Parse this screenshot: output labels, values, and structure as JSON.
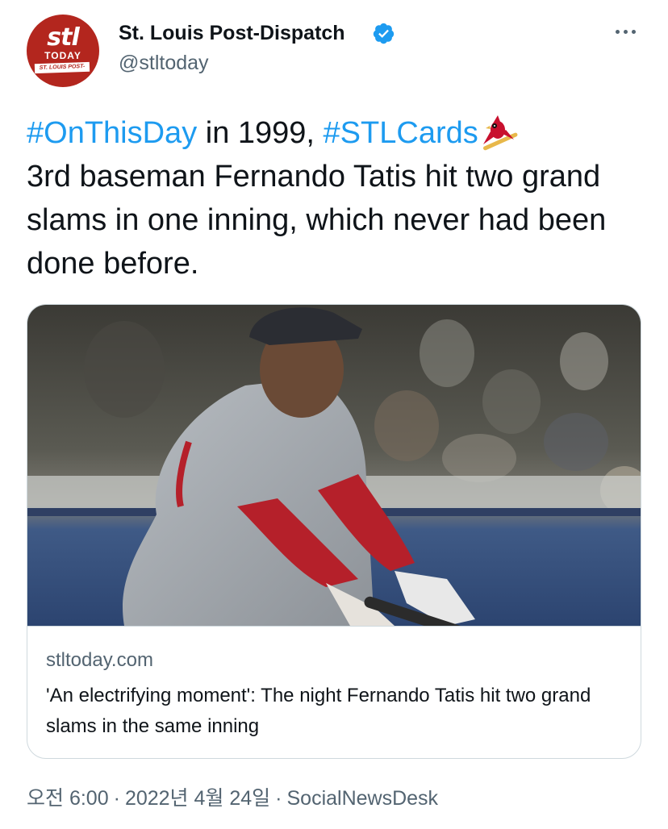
{
  "author": {
    "avatar_text_top": "stl",
    "avatar_text_mid": "TODAY",
    "avatar_text_band": "ST. LOUIS POST-DISPATCH",
    "display_name": "St. Louis Post-Dispatch",
    "handle": "@stltoday",
    "verified": true
  },
  "more_icon": "more-horizontal-icon",
  "tweet": {
    "hashtag_1": "#OnThisDay",
    "text_1": " in 1999, ",
    "hashtag_2": "#STLCards",
    "text_2": "3rd baseman Fernando Tatis hit two grand slams in one inning, which never had been done before."
  },
  "card": {
    "image_description_icon": "photo",
    "domain": "stltoday.com",
    "title": "'An electrifying moment': The night Fernando Tatis hit two grand slams in the same inning"
  },
  "footer": {
    "time": "오전 6:00",
    "separator": "·",
    "date": "2022년 4월 24일",
    "source": "SocialNewsDesk"
  },
  "colors": {
    "link": "#1d9bf0",
    "text": "#0f1419",
    "secondary": "#536471",
    "border": "#cfd9de",
    "avatar_bg": "#b3261e"
  }
}
